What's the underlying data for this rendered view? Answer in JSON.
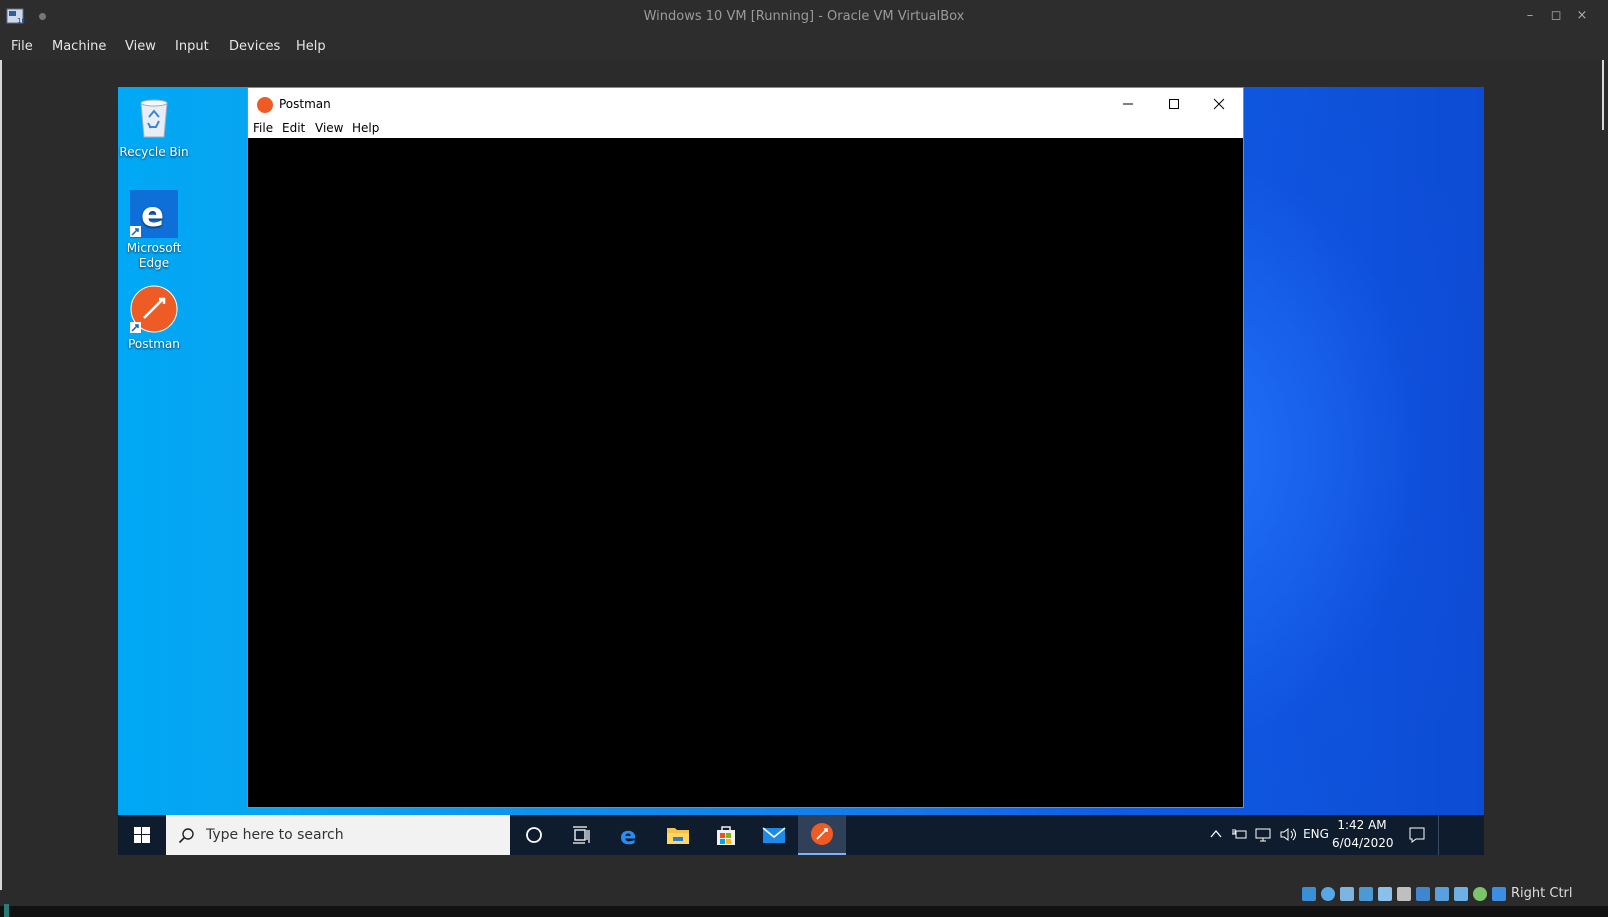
{
  "host": {
    "title": "Windows 10 VM [Running] - Oracle VM VirtualBox",
    "window_controls": [
      "–",
      "◻",
      "×"
    ],
    "menu": [
      "File",
      "Machine",
      "View",
      "Input",
      "Devices",
      "Help"
    ],
    "host_key": "Right Ctrl"
  },
  "desktop": {
    "icons": [
      {
        "label": "Recycle Bin",
        "icon": "recycle-bin-icon"
      },
      {
        "label": "Microsoft Edge",
        "icon": "edge-icon"
      },
      {
        "label": "Postman",
        "icon": "postman-icon"
      }
    ]
  },
  "postman": {
    "title": "Postman",
    "menu": [
      "File",
      "Edit",
      "View",
      "Help"
    ]
  },
  "taskbar": {
    "search_placeholder": "Type here to search",
    "language": "ENG",
    "time": "1:42 AM",
    "date": "6/04/2020",
    "pinned": [
      "cortana-icon",
      "task-view-icon",
      "edge-icon",
      "file-explorer-icon",
      "store-icon",
      "mail-icon",
      "postman-icon"
    ]
  },
  "colors": {
    "postman_orange": "#ef5b25",
    "taskbar_bg": "#0f1c2e",
    "host_bg": "#2d2d2d"
  }
}
